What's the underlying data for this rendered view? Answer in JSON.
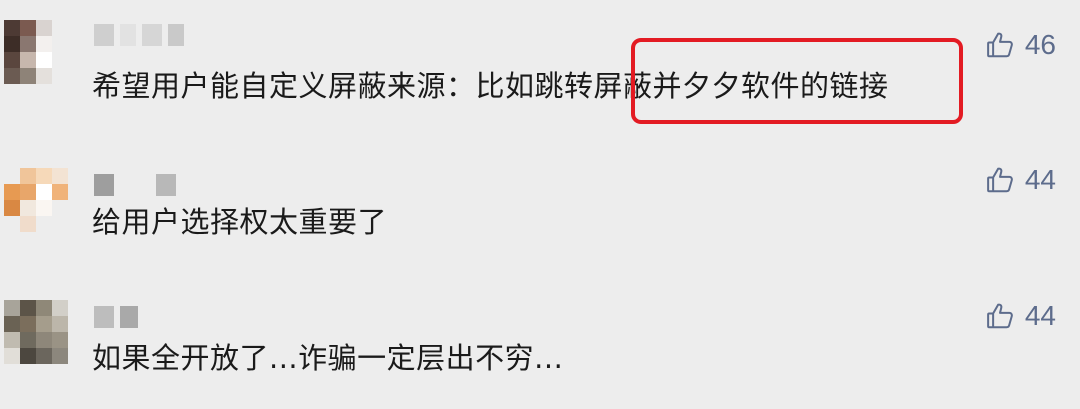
{
  "comments": [
    {
      "text": "希望用户能自定义屏蔽来源：比如跳转屏蔽并夕夕软件的链接",
      "likes": "46"
    },
    {
      "text": "给用户选择权太重要了",
      "likes": "44"
    },
    {
      "text": "如果全开放了...诈骗一定层出不穷...",
      "likes": "44"
    }
  ],
  "colors": {
    "background": "#ededed",
    "text": "#1a1a1a",
    "like_accent": "#5d6c8c",
    "highlight_box": "#e31b23"
  },
  "icons": {
    "like": "thumbs-up-icon"
  },
  "annotations": {
    "highlight_box": "red rounded rectangle around 屏蔽并夕夕软件的链接"
  }
}
